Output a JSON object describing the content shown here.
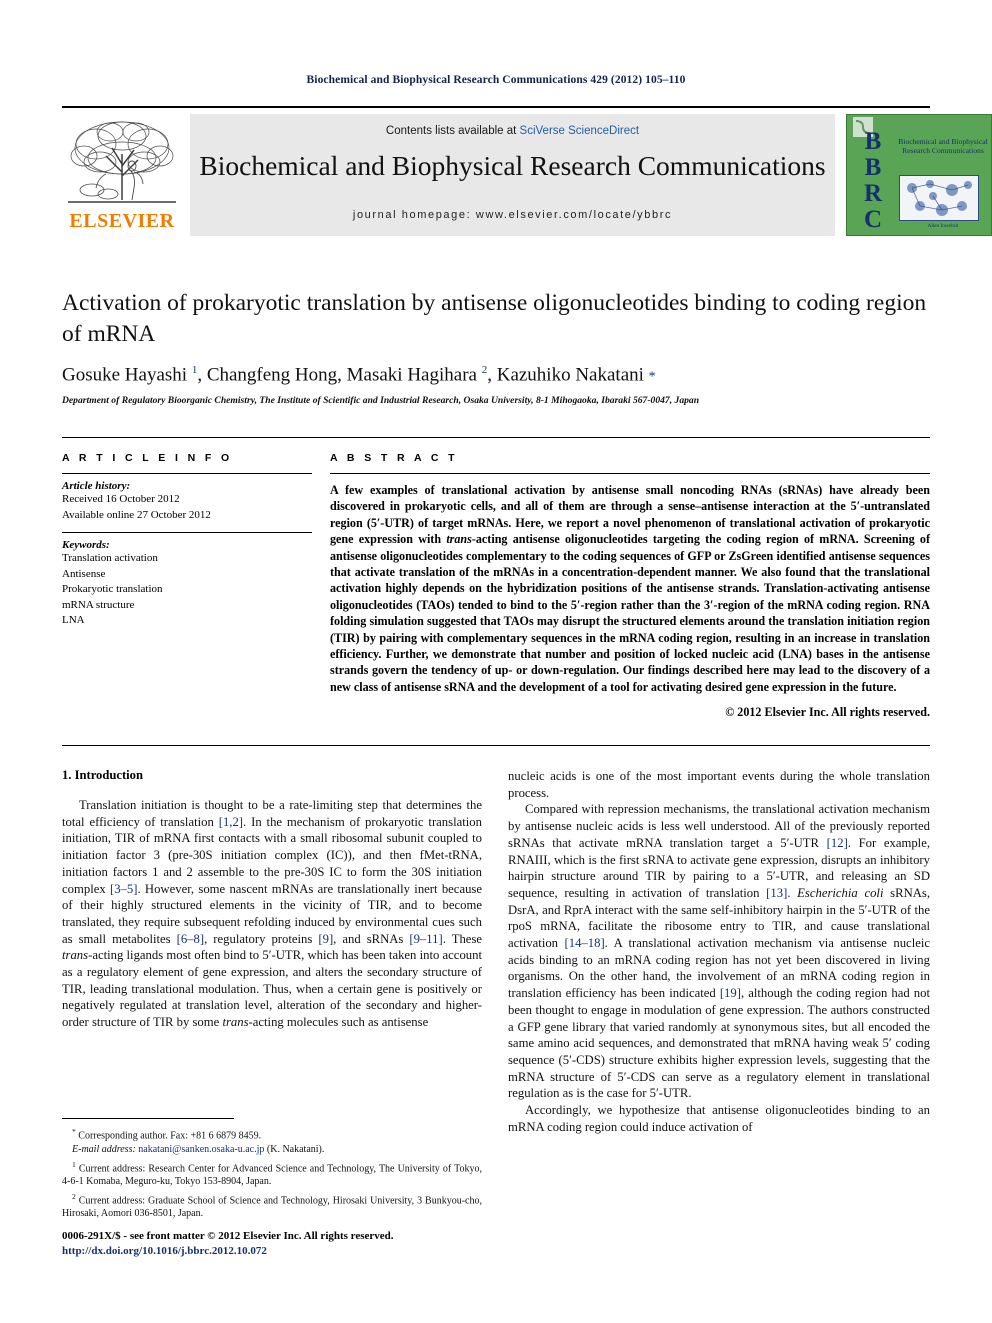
{
  "running_head": "Biochemical and Biophysical Research Communications 429 (2012) 105–110",
  "masthead": {
    "contents_prefix": "Contents lists available at ",
    "contents_link": "SciVerse ScienceDirect",
    "journal_title": "Biochemical and Biophysical Research Communications",
    "homepage": "journal homepage: www.elsevier.com/locate/ybbrc",
    "publisher_name": "ELSEVIER",
    "cover": {
      "letters": "B\nB\nR\nC",
      "title_lines": "Biochemical and Biophysical Research Communications",
      "footer": "Allen Inwebsit"
    }
  },
  "article": {
    "title": "Activation of prokaryotic translation by antisense oligonucleotides binding to coding region of mRNA",
    "authors_html": "Gosuke Hayashi <sup>1</sup>, Changfeng Hong, Masaki Hagihara <sup>2</sup>, Kazuhiko Nakatani <span class=\"star\">*</span>",
    "affiliation": "Department of Regulatory Bioorganic Chemistry, The Institute of Scientific and Industrial Research, Osaka University, 8-1 Mihogaoka, Ibaraki 567-0047, Japan"
  },
  "info": {
    "heading": "A R T I C L E    I N F O",
    "history_label": "Article history:",
    "received": "Received 16 October 2012",
    "available": "Available online 27 October 2012",
    "keywords_label": "Keywords:",
    "keywords": [
      "Translation activation",
      "Antisense",
      "Prokaryotic translation",
      "mRNA structure",
      "LNA"
    ]
  },
  "abstract": {
    "heading": "A B S T R A C T",
    "body_html": "A few examples of translational activation by antisense small noncoding RNAs (sRNAs) have already been discovered in prokaryotic cells, and all of them are through a sense–antisense interaction at the 5′-untranslated region (5′-UTR) of target mRNAs. Here, we report a novel phenomenon of translational activation of prokaryotic gene expression with <i>trans</i>-acting antisense oligonucleotides targeting the coding region of mRNA. Screening of antisense oligonucleotides complementary to the coding sequences of GFP or ZsGreen identified antisense sequences that activate translation of the mRNAs in a concentration-dependent manner. We also found that the translational activation highly depends on the hybridization positions of the antisense strands. Translation-activating antisense oligonucleotides (TAOs) tended to bind to the 5′-region rather than the 3′-region of the mRNA coding region. RNA folding simulation suggested that TAOs may disrupt the structured elements around the translation initiation region (TIR) by pairing with complementary sequences in the mRNA coding region, resulting in an increase in translation efficiency. Further, we demonstrate that number and position of locked nucleic acid (LNA) bases in the antisense strands govern the tendency of up- or down-regulation. Our findings described here may lead to the discovery of a new class of antisense sRNA and the development of a tool for activating desired gene expression in the future.",
    "copyright": "© 2012 Elsevier Inc. All rights reserved."
  },
  "body": {
    "section_heading": "1. Introduction",
    "left_paragraphs_html": [
      "Translation initiation is thought to be a rate-limiting step that determines the total efficiency of translation <span class=\"ref\">[1,2]</span>. In the mechanism of prokaryotic translation initiation, TIR of mRNA first contacts with a small ribosomal subunit coupled to initiation factor 3 (pre-30S initiation complex (IC)), and then fMet-tRNA, initiation factors 1 and 2 assemble to the pre-30S IC to form the 30S initiation complex <span class=\"ref\">[3–5]</span>. However, some nascent mRNAs are translationally inert because of their highly structured elements in the vicinity of TIR, and to become translated, they require subsequent refolding induced by environmental cues such as small metabolites <span class=\"ref\">[6–8]</span>, regulatory proteins <span class=\"ref\">[9]</span>, and sRNAs <span class=\"ref\">[9–11]</span>. These <i>trans</i>-acting ligands most often bind to 5′-UTR, which has been taken into account as a regulatory element of gene expression, and alters the secondary structure of TIR, leading translational modulation. Thus, when a certain gene is positively or negatively regulated at translation level, alteration of the secondary and higher-order structure of TIR by some <i>trans</i>-acting molecules such as antisense"
    ],
    "right_paragraphs_html": [
      "nucleic acids is one of the most important events during the whole translation process.",
      "Compared with repression mechanisms, the translational activation mechanism by antisense nucleic acids is less well understood. All of the previously reported sRNAs that activate mRNA translation target a 5′-UTR <span class=\"ref\">[12]</span>. For example, RNAIII, which is the first sRNA to activate gene expression, disrupts an inhibitory hairpin structure around TIR by pairing to a 5′-UTR, and releasing an SD sequence, resulting in activation of translation <span class=\"ref\">[13]</span>. <i>Escherichia coli</i> sRNAs, DsrA, and RprA interact with the same self-inhibitory hairpin in the 5′-UTR of the rpoS mRNA, facilitate the ribosome entry to TIR, and cause translational activation <span class=\"ref\">[14–18]</span>. A translational activation mechanism via antisense nucleic acids binding to an mRNA coding region has not yet been discovered in living organisms. On the other hand, the involvement of an mRNA coding region in translation efficiency has been indicated <span class=\"ref\">[19]</span>, although the coding region had not been thought to engage in modulation of gene expression. The authors constructed a GFP gene library that varied randomly at synonymous sites, but all encoded the same amino acid sequences, and demonstrated that mRNA having weak 5′ coding sequence (5′-CDS) structure exhibits higher expression levels, suggesting that the mRNA structure of 5′-CDS can serve as a regulatory element in translational regulation as is the case for 5′-UTR.",
      "Accordingly, we hypothesize that antisense oligonucleotides binding to an mRNA coding region could induce activation of"
    ]
  },
  "footnotes_html": [
    "<sup>*</sup> Corresponding author. Fax: +81 6 6879 8459.",
    "<i>E-mail address:</i> <span class=\"link\">nakatani@sanken.osaka-u.ac.jp</span> (K. Nakatani).",
    "<sup>1</sup> Current address: Research Center for Advanced Science and Technology, The University of Tokyo, 4-6-1 Komaba, Meguro-ku, Tokyo 153-8904, Japan.",
    "<sup>2</sup> Current address: Graduate School of Science and Technology, Hirosaki University, 3 Bunkyou-cho, Hirosaki, Aomori 036-8501, Japan."
  ],
  "imprint": {
    "line1": "0006-291X/$ - see front matter © 2012 Elsevier Inc. All rights reserved.",
    "doi": "http://dx.doi.org/10.1016/j.bbrc.2012.10.072"
  },
  "colors": {
    "running_head": "#15204d",
    "link": "#2060a8",
    "reference": "#16306e",
    "elsevier_orange": "#f07d00",
    "cover_green": "#5aa555",
    "band_gray": "#e8e8e8"
  }
}
